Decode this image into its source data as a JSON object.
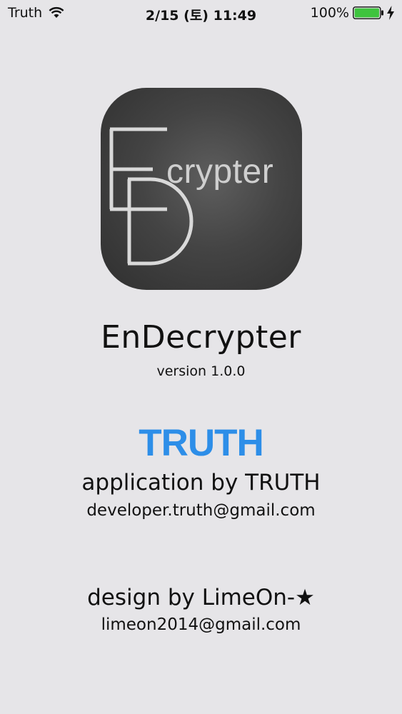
{
  "status_bar": {
    "carrier": "Truth",
    "time": "2/15 (토) 11:49",
    "battery_percent": "100%",
    "battery_level": 1.0,
    "battery_color": "#3ec43e",
    "icons": [
      "wifi-icon",
      "battery-icon",
      "charging-bolt-icon"
    ]
  },
  "app_icon": {
    "letters_e": "E",
    "letters_d": "D",
    "text": "crypter"
  },
  "app": {
    "name": "EnDecrypter",
    "version": "version 1.0.0"
  },
  "developer": {
    "logo_text": "TRUTH",
    "logo_color": "#2d8ee8",
    "credit": "application by TRUTH",
    "email": "developer.truth@gmail.com"
  },
  "designer": {
    "credit": "design by LimeOn-★",
    "email": "limeon2014@gmail.com"
  }
}
